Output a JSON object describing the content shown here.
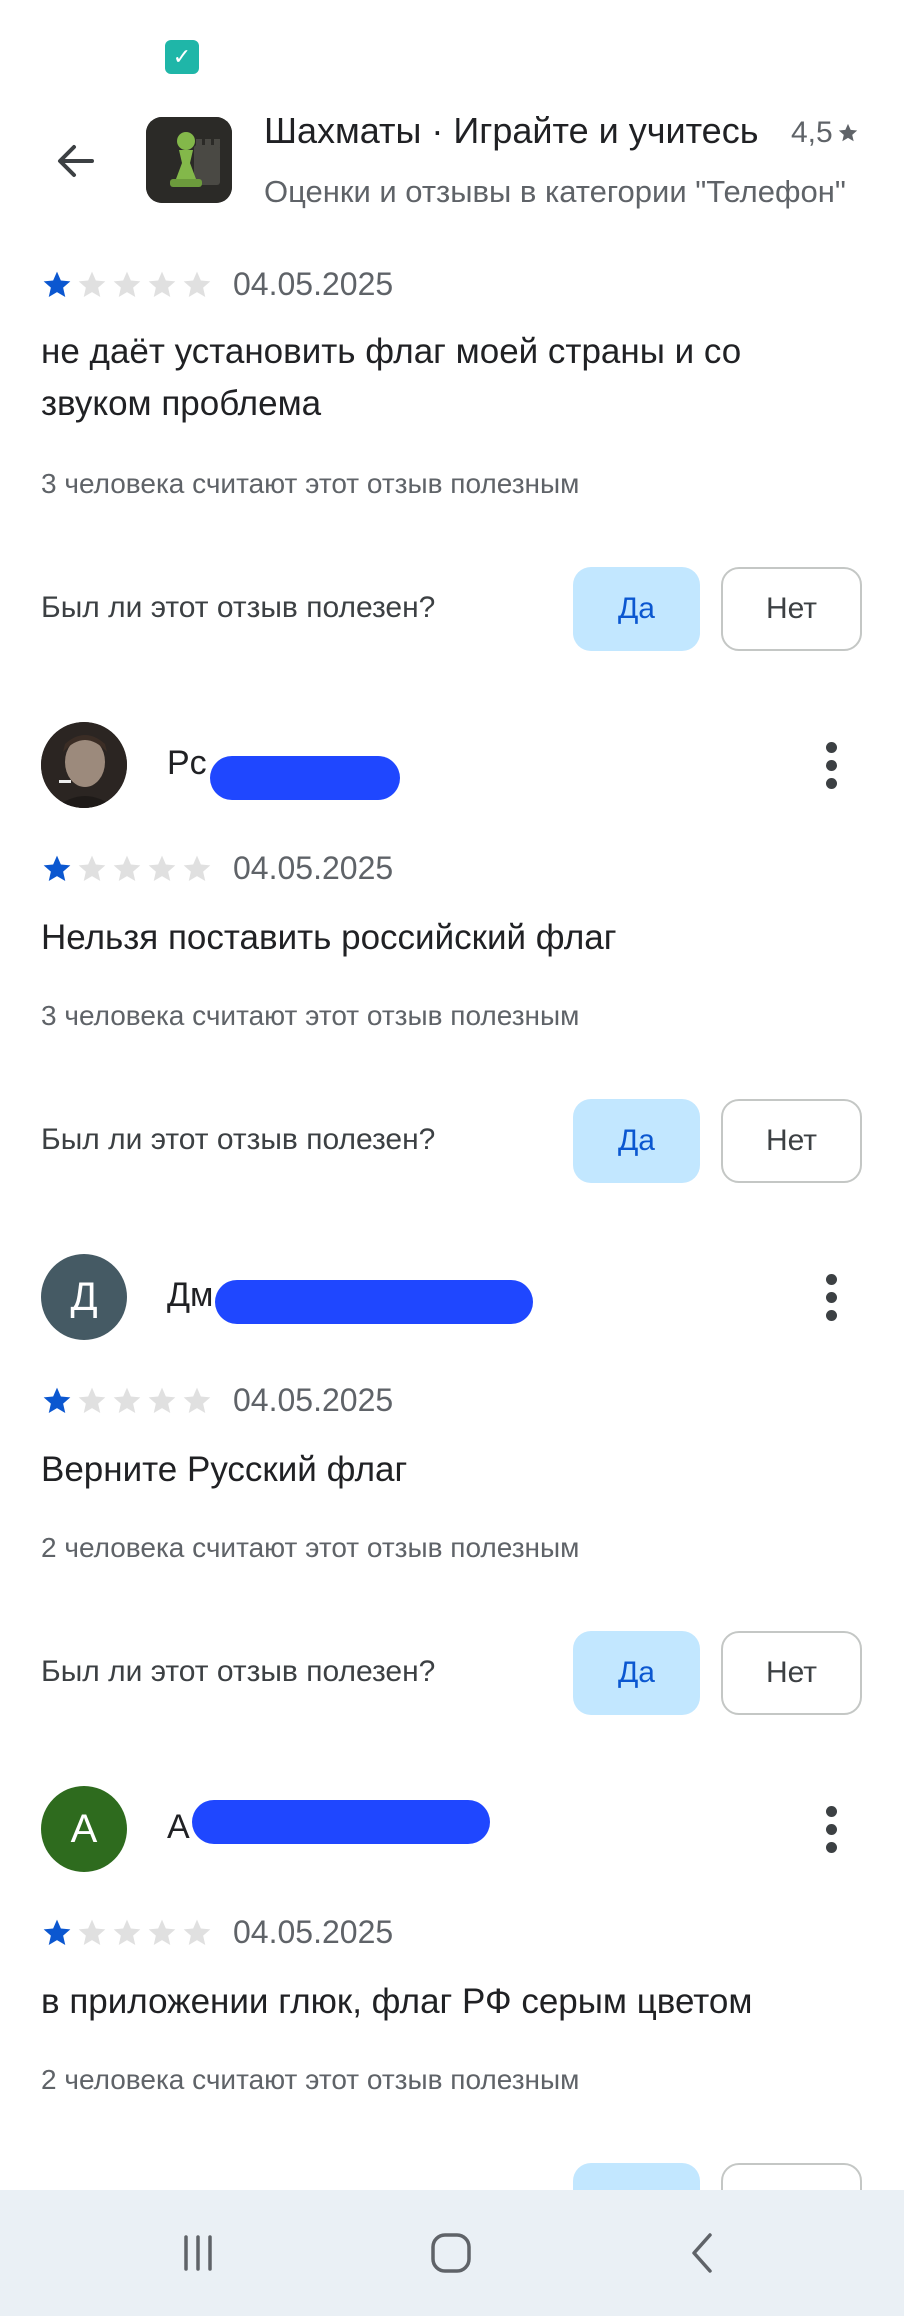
{
  "status_bar": {
    "icon": "check-square-icon"
  },
  "header": {
    "back_icon": "arrow-left-icon",
    "app_icon": "chess-pawn-icon",
    "title": "Шахматы · Играйте и учитесь",
    "subtitle": "Оценки и отзывы в категории \"Телефон\"",
    "rating": "4,5",
    "rating_icon": "star-icon"
  },
  "reviews": [
    {
      "reviewer": "",
      "avatar_letter": "",
      "rating": 1,
      "date": "04.05.2025",
      "text": "не даёт установить флаг моей страны и со звуком проблема",
      "helpful_count": "3 человека считают этот отзыв полезным",
      "helpful_question": "Был ли этот отзыв полезен?",
      "yes_label": "Да",
      "no_label": "Нет"
    },
    {
      "reviewer": "Pc",
      "avatar_letter": "",
      "rating": 1,
      "date": "04.05.2025",
      "text": "Нельзя поставить российский флаг",
      "helpful_count": "3 человека считают этот отзыв полезным",
      "helpful_question": "Был ли этот отзыв полезен?",
      "yes_label": "Да",
      "no_label": "Нет"
    },
    {
      "reviewer": "Дм",
      "avatar_letter": "Д",
      "avatar_color": "#455a64",
      "rating": 1,
      "date": "04.05.2025",
      "text": "Верните Русский флаг",
      "helpful_count": "2 человека считают этот отзыв полезным",
      "helpful_question": "Был ли этот отзыв полезен?",
      "yes_label": "Да",
      "no_label": "Нет"
    },
    {
      "reviewer": "А",
      "avatar_letter": "А",
      "avatar_color": "#2e6b1e",
      "rating": 1,
      "date": "04.05.2025",
      "text": "в приложении глюк, флаг РФ серым цветом",
      "helpful_count": "2 человека считают этот отзыв полезным"
    }
  ],
  "colors": {
    "star_filled": "#0b57d0",
    "star_empty": "#e0e0e0",
    "yes_bg": "#c2e7ff",
    "scribble": "#1f47ff"
  },
  "navbar": {
    "recents_icon": "recent-apps-icon",
    "home_icon": "home-icon",
    "back_icon": "back-chevron-icon"
  }
}
